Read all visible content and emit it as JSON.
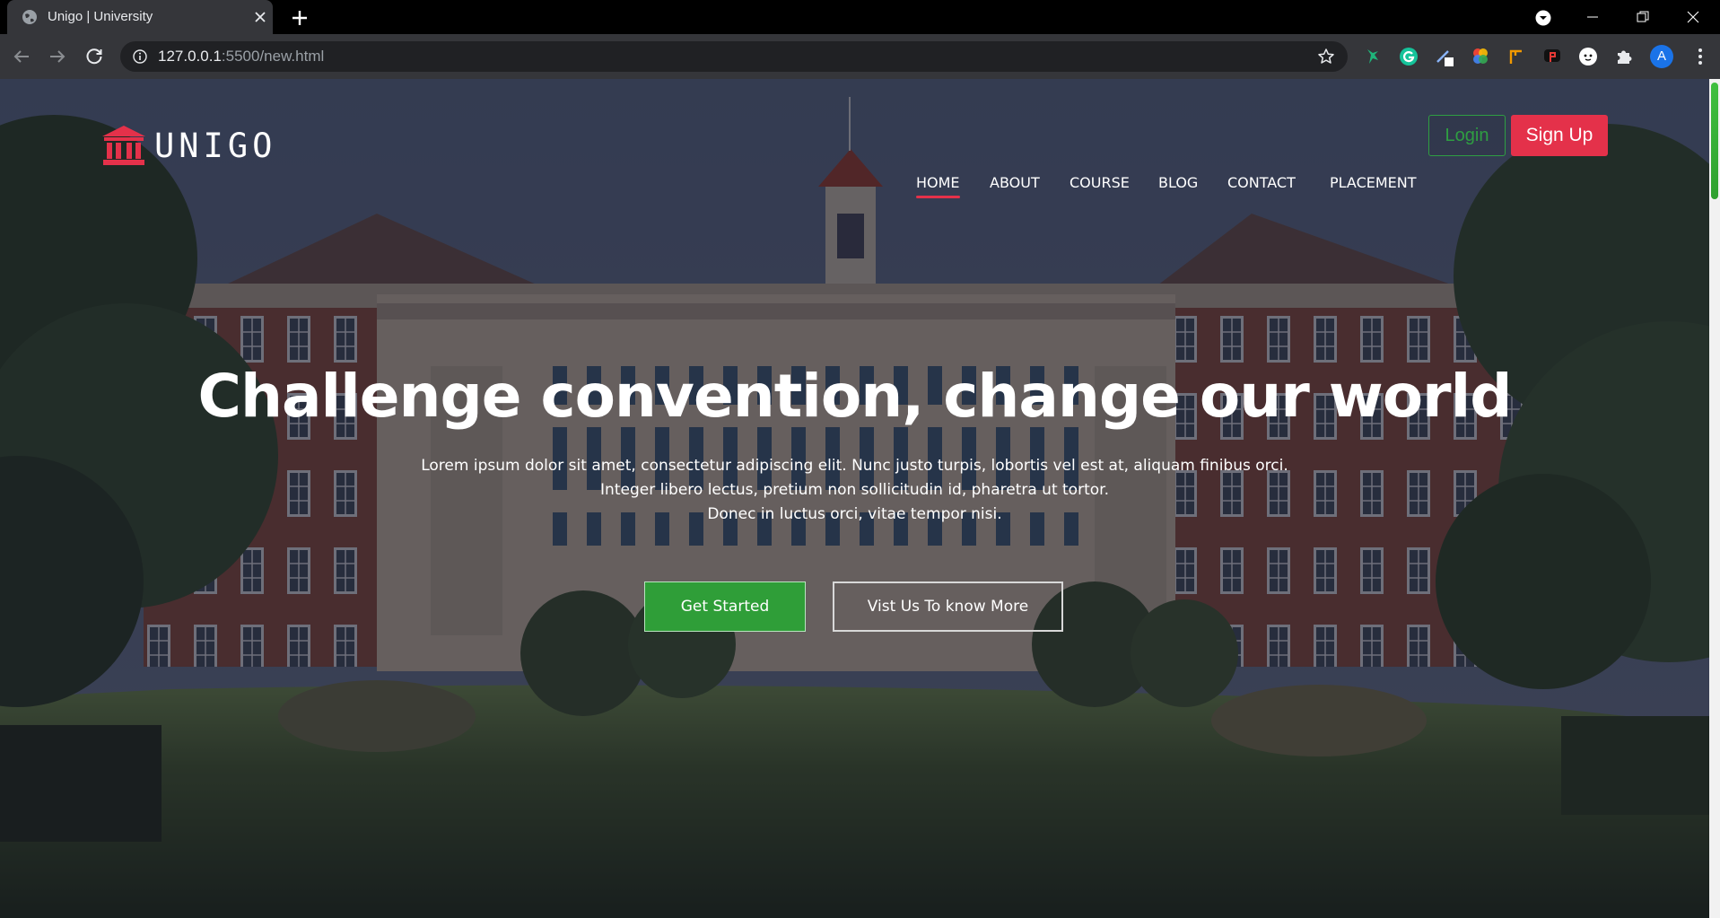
{
  "browser": {
    "tab_title": "Unigo | University",
    "url_host": "127.0.0.1",
    "url_rest": ":5500/new.html",
    "profile_initial": "A",
    "extensions": [
      "bird-extension-icon",
      "grammarly-icon",
      "pen-extension-icon",
      "color-wheel-icon",
      "orange-extension-icon",
      "red-black-extension-icon",
      "cat-extension-icon",
      "puzzle-icon"
    ]
  },
  "site": {
    "logo_text": "UNIGO",
    "nav": [
      "HOME",
      "ABOUT",
      "COURSE",
      "BLOG",
      "CONTACT",
      "PLACEMENT"
    ],
    "active_nav": "HOME",
    "login_label": "Login",
    "signup_label": "Sign Up"
  },
  "hero": {
    "title": "Challenge convention, change our world",
    "lines": [
      "Lorem ipsum dolor sit amet, consectetur adipiscing elit. Nunc justo turpis, lobortis vel est at, aliquam finibus orci.",
      "Integer libero lectus, pretium non sollicitudin id, pharetra ut tortor.",
      "Donec in luctus orci, vitae tempor nisi."
    ],
    "primary_button": "Get Started",
    "secondary_button": "Vist Us To know More"
  },
  "colors": {
    "accent_red": "#e4314a",
    "accent_green": "#2f9e38",
    "chrome_bg": "#35363a"
  }
}
